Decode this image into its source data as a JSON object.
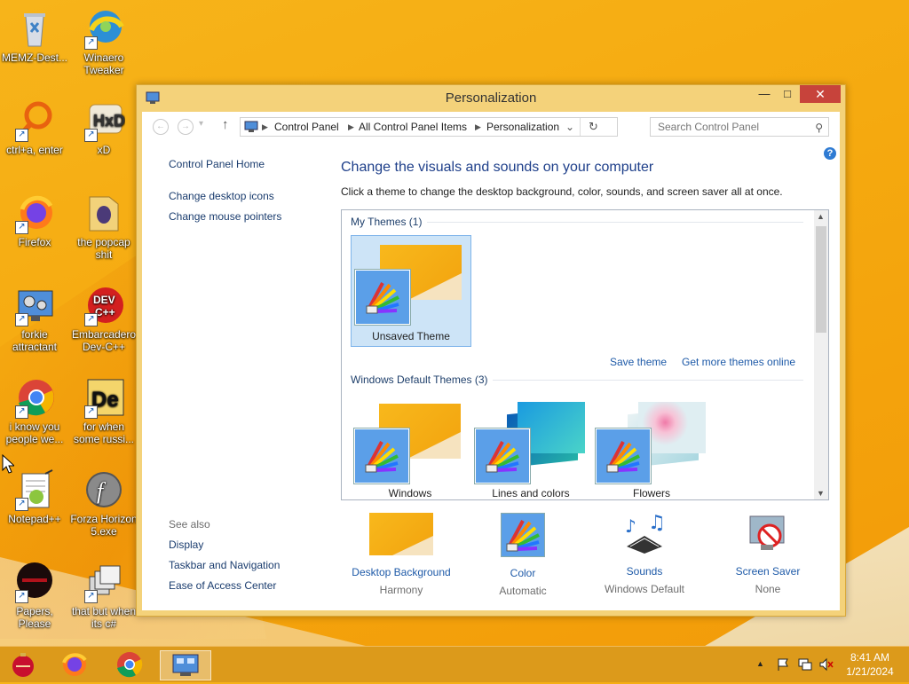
{
  "desktop": {
    "icons": [
      {
        "label": "MEMZ-Dest..."
      },
      {
        "label": "Winaero Tweaker"
      },
      {
        "label": "ctrl+a, enter"
      },
      {
        "label": "xD"
      },
      {
        "label": "Firefox"
      },
      {
        "label": "the popcap shit"
      },
      {
        "label": "forkie attractant"
      },
      {
        "label": "Embarcadero Dev-C++"
      },
      {
        "label": "i know you people we..."
      },
      {
        "label": "for when some russi..."
      },
      {
        "label": "Notepad++"
      },
      {
        "label": "Forza Horizon 5.exe"
      },
      {
        "label": "Papers, Please"
      },
      {
        "label": "that but when its c#"
      }
    ]
  },
  "window": {
    "title": "Personalization",
    "controls": {
      "minimize": "—",
      "maximize": "□",
      "close": "✕"
    },
    "nav": {
      "back": "←",
      "forward": "→",
      "up": "↑",
      "address": [
        "Control Panel",
        "All Control Panel Items",
        "Personalization"
      ],
      "search_placeholder": "Search Control Panel"
    },
    "sidebar": {
      "home": "Control Panel Home",
      "links": [
        "Change desktop icons",
        "Change mouse pointers"
      ],
      "see_also_title": "See also",
      "see_also": [
        "Display",
        "Taskbar and Navigation",
        "Ease of Access Center"
      ]
    },
    "main": {
      "heading": "Change the visuals and sounds on your computer",
      "description": "Click a theme to change the desktop background, color, sounds, and screen saver all at once.",
      "my_themes_title": "My Themes (1)",
      "my_themes": [
        {
          "name": "Unsaved Theme",
          "selected": true
        }
      ],
      "save_theme": "Save theme",
      "get_more": "Get more themes online",
      "default_themes_title": "Windows Default Themes (3)",
      "default_themes": [
        {
          "name": "Windows"
        },
        {
          "name": "Lines and colors"
        },
        {
          "name": "Flowers"
        }
      ]
    },
    "bottom": [
      {
        "label": "Desktop Background",
        "value": "Harmony"
      },
      {
        "label": "Color",
        "value": "Automatic"
      },
      {
        "label": "Sounds",
        "value": "Windows Default"
      },
      {
        "label": "Screen Saver",
        "value": "None"
      }
    ],
    "help": "?"
  },
  "taskbar": {
    "time": "8:41 AM",
    "date": "1/21/2024",
    "tray_expand": "▲"
  },
  "colors": {
    "accent": "#1e5aa8",
    "close": "#c7433b",
    "taskbar": "#dc9a1b"
  }
}
